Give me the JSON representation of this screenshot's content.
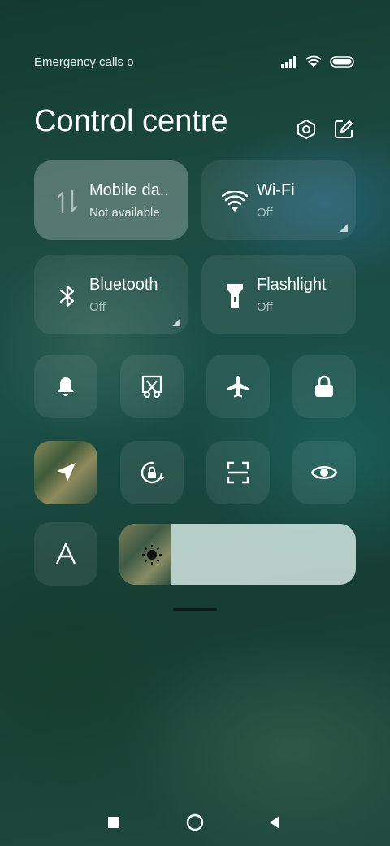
{
  "status_bar": {
    "carrier_text": "Emergency calls o"
  },
  "header": {
    "title": "Control centre"
  },
  "tiles": [
    {
      "name": "Mobile da..",
      "status": "Not available",
      "icon": "data-arrows-icon",
      "active": true
    },
    {
      "name": "Wi-Fi",
      "status": "Off",
      "icon": "wifi-icon",
      "active": false
    },
    {
      "name": "Bluetooth",
      "status": "Off",
      "icon": "bluetooth-icon",
      "active": false
    },
    {
      "name": "Flashlight",
      "status": "Off",
      "icon": "flashlight-icon",
      "active": false
    }
  ],
  "toggles": [
    {
      "icon": "bell-icon",
      "active": false
    },
    {
      "icon": "screenshot-scissors-icon",
      "active": false
    },
    {
      "icon": "airplane-icon",
      "active": false
    },
    {
      "icon": "lock-icon",
      "active": false
    },
    {
      "icon": "location-icon",
      "active": true
    },
    {
      "icon": "rotation-lock-icon",
      "active": false
    },
    {
      "icon": "scanner-icon",
      "active": false
    },
    {
      "icon": "eye-icon",
      "active": false
    },
    {
      "icon": "auto-brightness-icon",
      "active": false
    }
  ],
  "brightness": {
    "level": 0.22
  },
  "nav": [
    "recents-icon",
    "home-icon",
    "back-icon"
  ]
}
